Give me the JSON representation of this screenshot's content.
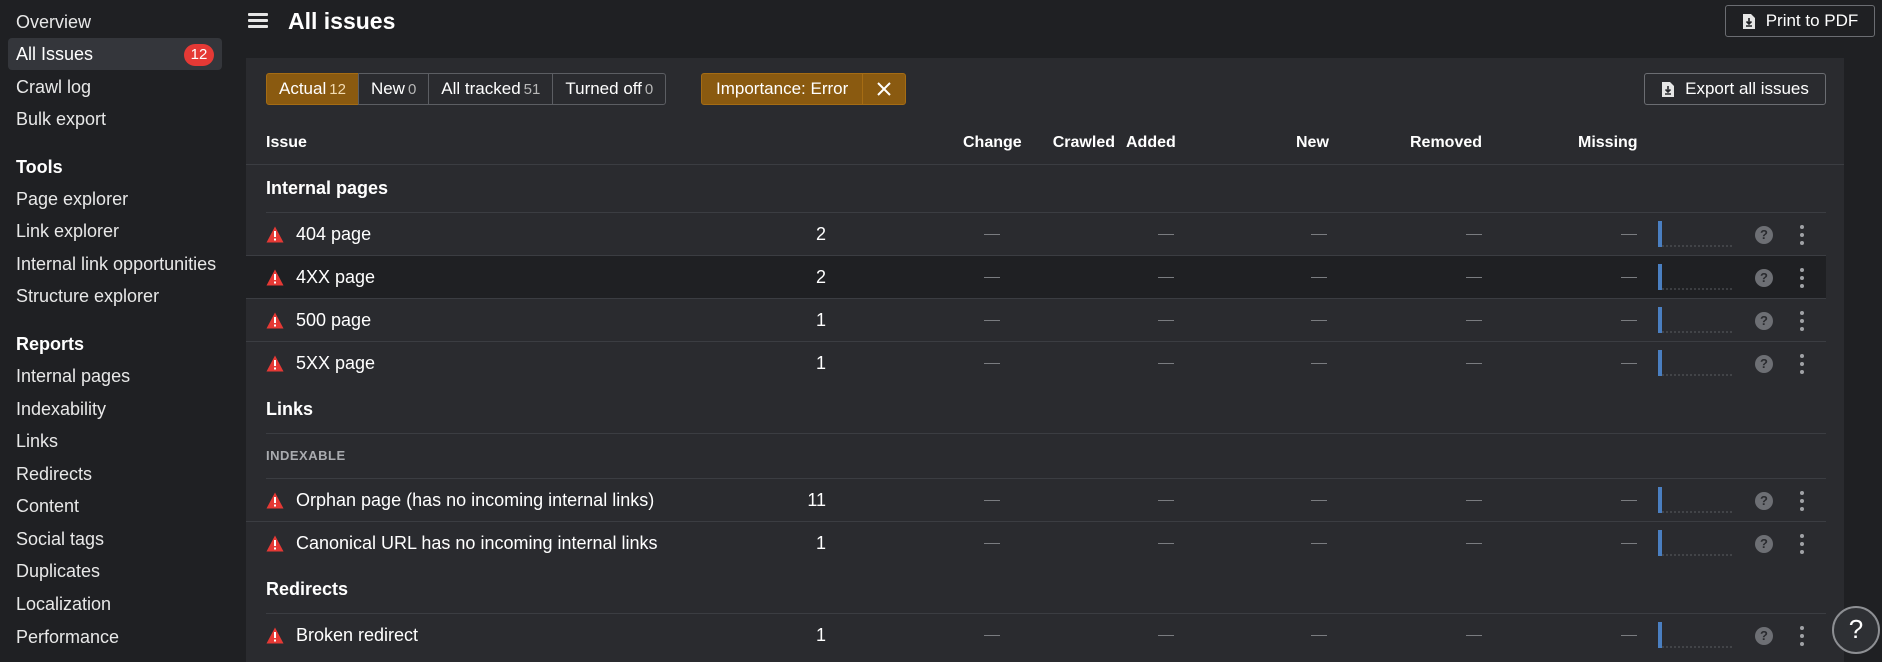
{
  "sidebar": {
    "top_items": [
      {
        "label": "Overview"
      },
      {
        "label": "All Issues",
        "badge": "12",
        "active": true
      },
      {
        "label": "Crawl log"
      },
      {
        "label": "Bulk export"
      }
    ],
    "tools_heading": "Tools",
    "tools_items": [
      {
        "label": "Page explorer"
      },
      {
        "label": "Link explorer"
      },
      {
        "label": "Internal link opportunities"
      },
      {
        "label": "Structure explorer"
      }
    ],
    "reports_heading": "Reports",
    "reports_items": [
      {
        "label": "Internal pages"
      },
      {
        "label": "Indexability"
      },
      {
        "label": "Links"
      },
      {
        "label": "Redirects"
      },
      {
        "label": "Content"
      },
      {
        "label": "Social tags"
      },
      {
        "label": "Duplicates"
      },
      {
        "label": "Localization"
      },
      {
        "label": "Performance"
      }
    ]
  },
  "header": {
    "title": "All issues",
    "print_label": "Print to PDF"
  },
  "filters": {
    "segments": [
      {
        "label": "Actual",
        "count": "12",
        "active": true
      },
      {
        "label": "New",
        "count": "0"
      },
      {
        "label": "All tracked",
        "count": "51"
      },
      {
        "label": "Turned off",
        "count": "0"
      }
    ],
    "importance_label": "Importance: Error",
    "export_label": "Export all issues"
  },
  "table": {
    "columns": {
      "issue": "Issue",
      "crawled": "Crawled",
      "change": "Change",
      "added": "Added",
      "new": "New",
      "removed": "Removed",
      "missing": "Missing"
    },
    "empty_value": "—",
    "help_glyph": "?",
    "sections": [
      {
        "title": "Internal pages",
        "rows": [
          {
            "issue": "404 page",
            "crawled": "2"
          },
          {
            "issue": "4XX page",
            "crawled": "2"
          },
          {
            "issue": "500 page",
            "crawled": "1"
          },
          {
            "issue": "5XX page",
            "crawled": "1"
          }
        ]
      },
      {
        "title": "Links",
        "group": "INDEXABLE",
        "rows": [
          {
            "issue": "Orphan page (has no incoming internal links)",
            "crawled": "11"
          },
          {
            "issue": "Canonical URL has no incoming internal links",
            "crawled": "1"
          }
        ]
      },
      {
        "title": "Redirects",
        "rows": [
          {
            "issue": "Broken redirect",
            "crawled": "1"
          }
        ]
      }
    ]
  },
  "float_help": "?",
  "colors": {
    "accent_orange": "#8a5a10",
    "error_red": "#e53935",
    "spark_blue": "#4a7fc1"
  }
}
